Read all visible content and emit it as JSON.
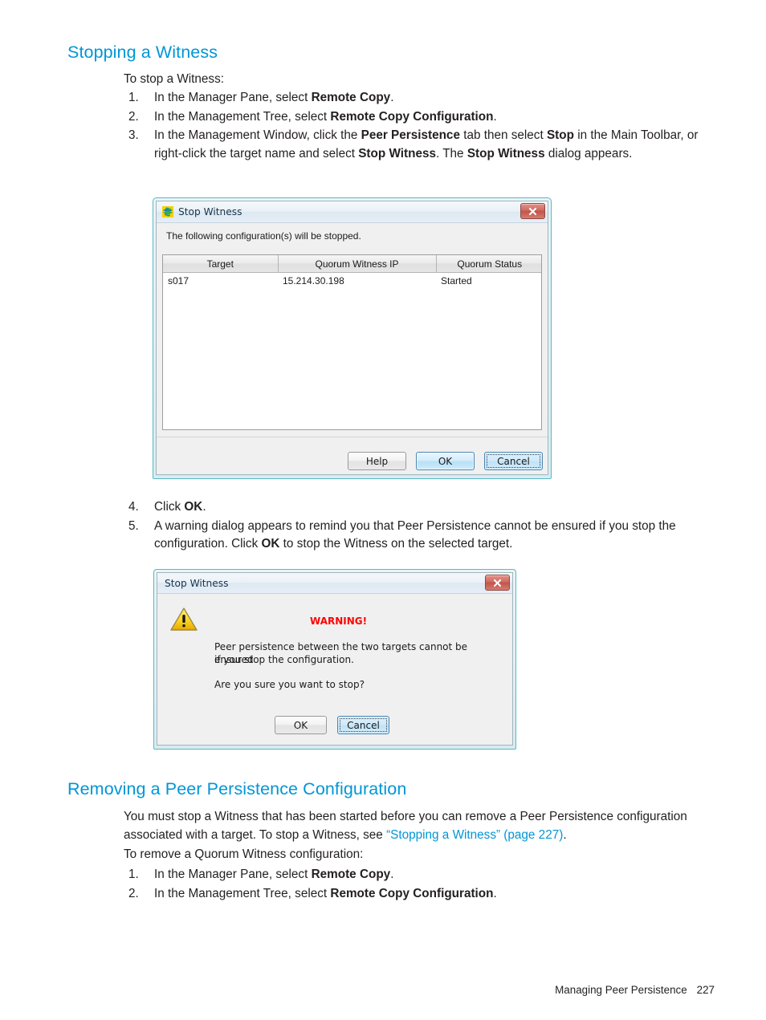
{
  "page": {
    "footer_text": "Managing Peer Persistence",
    "footer_page": "227"
  },
  "section1": {
    "heading": "Stopping a Witness",
    "intro": "To stop a Witness:",
    "steps": [
      {
        "num": "1.",
        "html": "In the Manager Pane, select <b>Remote Copy</b>."
      },
      {
        "num": "2.",
        "html": "In the Management Tree, select <b>Remote Copy Configuration</b>."
      },
      {
        "num": "3.",
        "html": "In the Management Window, click the <b>Peer Persistence</b> tab then select <b>Stop</b> in the Main Toolbar, or right-click the target name and select <b>Stop Witness</b>. The <b>Stop Witness</b> dialog appears."
      }
    ],
    "steps2": [
      {
        "num": "4.",
        "html": "Click <b>OK</b>."
      },
      {
        "num": "5.",
        "html": "A warning dialog appears to remind you that Peer Persistence cannot be ensured if you stop the configuration. Click <b>OK</b> to stop the Witness on the selected target."
      }
    ]
  },
  "stop_witness_dialog": {
    "title": "Stop Witness",
    "icon_name": "stacked-layers-icon",
    "close_label": "x",
    "instruction": "The following configuration(s) will be stopped.",
    "table": {
      "headers": [
        "Target",
        "Quorum Witness IP",
        "Quorum Status"
      ],
      "rows": [
        [
          "s017",
          "15.214.30.198",
          "Started"
        ]
      ]
    },
    "buttons": {
      "help": "Help",
      "ok": "OK",
      "cancel": "Cancel"
    }
  },
  "warning_dialog": {
    "title": "Stop Witness",
    "close_label": "x",
    "icon_name": "warning-triangle-icon",
    "warning_label": "WARNING!",
    "body_line1": "Peer persistence between the two targets cannot be ensured",
    "body_line2": "if you stop the configuration.",
    "body_line3": "Are you sure you want to stop?",
    "buttons": {
      "ok": "OK",
      "cancel": "Cancel"
    }
  },
  "section2": {
    "heading": "Removing a Peer Persistence Configuration",
    "para_part1": "You must stop a Witness that has been started before you can remove a Peer Persistence configuration associated with a target. To stop a Witness, see ",
    "para_link": "“Stopping a Witness” (page 227)",
    "para_part2": ".",
    "intro": "To remove a Quorum Witness configuration:",
    "steps": [
      {
        "num": "1.",
        "html": "In the Manager Pane, select <b>Remote Copy</b>."
      },
      {
        "num": "2.",
        "html": "In the Management Tree, select <b>Remote Copy Configuration</b>."
      }
    ]
  },
  "colors": {
    "heading": "#0096d6",
    "link": "#0096d6",
    "warning": "#ff0000",
    "dialog_frame": "#57b9c6"
  }
}
